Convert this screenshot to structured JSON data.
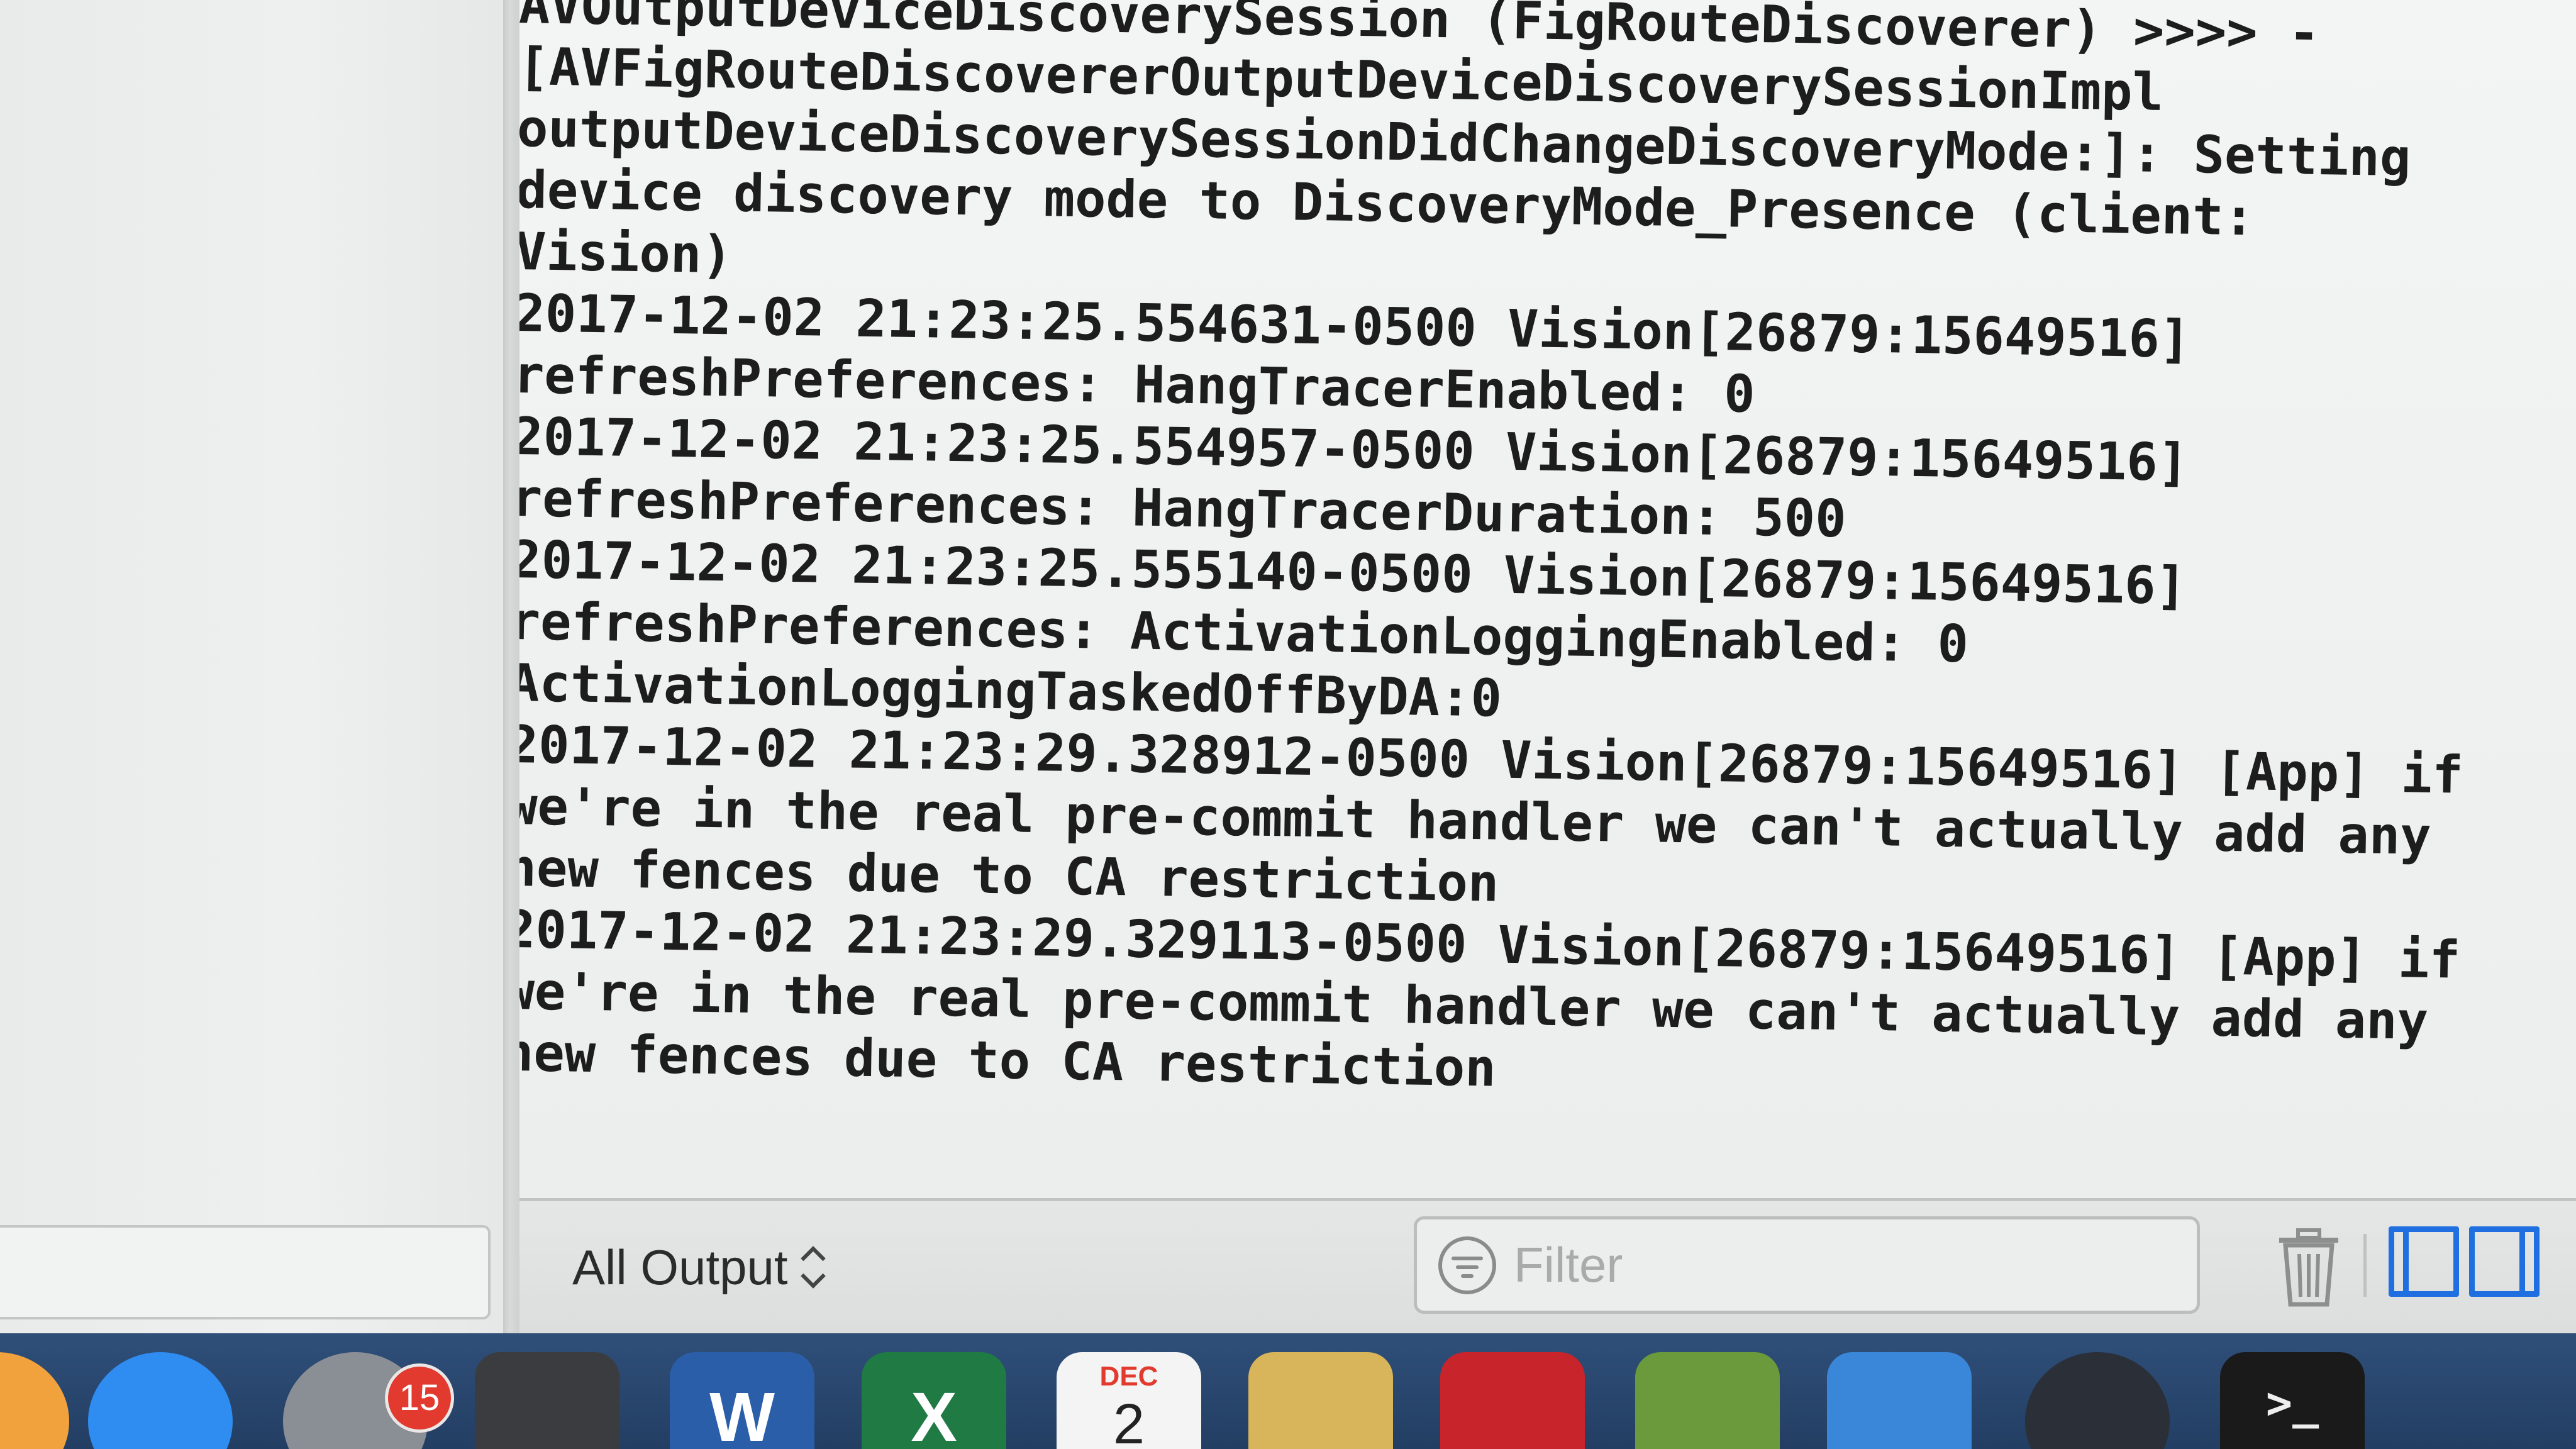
{
  "console": {
    "lines": [
      "AVOutputDeviceDiscoverySession (FigRouteDiscoverer) >>>> -",
      "[AVFigRouteDiscovererOutputDeviceDiscoverySessionImpl",
      "outputDeviceDiscoverySessionDidChangeDiscoveryMode:]: Setting",
      "device discovery mode to DiscoveryMode_Presence (client:",
      "Vision)",
      "2017-12-02 21:23:25.554631-0500 Vision[26879:15649516]",
      "refreshPreferences: HangTracerEnabled: 0",
      "2017-12-02 21:23:25.554957-0500 Vision[26879:15649516]",
      "refreshPreferences: HangTracerDuration: 500",
      "2017-12-02 21:23:25.555140-0500 Vision[26879:15649516]",
      "refreshPreferences: ActivationLoggingEnabled: 0",
      "ActivationLoggingTaskedOffByDA:0",
      "2017-12-02 21:23:29.328912-0500 Vision[26879:15649516] [App] if",
      "we're in the real pre-commit handler we can't actually add any",
      "new fences due to CA restriction",
      "2017-12-02 21:23:29.329113-0500 Vision[26879:15649516] [App] if",
      "we're in the real pre-commit handler we can't actually add any",
      "new fences due to CA restriction"
    ]
  },
  "toolbar": {
    "output_select_label": "All Output",
    "filter_placeholder": "Filter"
  },
  "dock": {
    "badge_count": "15",
    "calendar_month": "DEC",
    "calendar_day": "2",
    "word_letter": "W",
    "excel_letter": "X",
    "terminal_prompt": ">_",
    "apps": [
      {
        "name": "pages-icon",
        "color": "#f2a23c"
      },
      {
        "name": "app-store-icon",
        "color": "#2f8cf0"
      },
      {
        "name": "system-preferences-icon",
        "color": "#8a8f96"
      },
      {
        "name": "sublime-text-icon",
        "color": "#3a3c40"
      },
      {
        "name": "word-icon",
        "color": "#2b5ea8"
      },
      {
        "name": "excel-icon",
        "color": "#1f7a44"
      },
      {
        "name": "calendar-icon",
        "color": "#f4f4f4"
      },
      {
        "name": "sequel-pro-icon",
        "color": "#d8b45a"
      },
      {
        "name": "filezilla-icon",
        "color": "#c8242b"
      },
      {
        "name": "packages-icon",
        "color": "#6a9a3c"
      },
      {
        "name": "xcode-icon",
        "color": "#3a86d8"
      },
      {
        "name": "quicktime-icon",
        "color": "#2a2f38"
      },
      {
        "name": "terminal-icon",
        "color": "#1a1a1a"
      }
    ]
  },
  "colors": {
    "accent": "#1f6fe0",
    "badge": "#e23a2e"
  }
}
